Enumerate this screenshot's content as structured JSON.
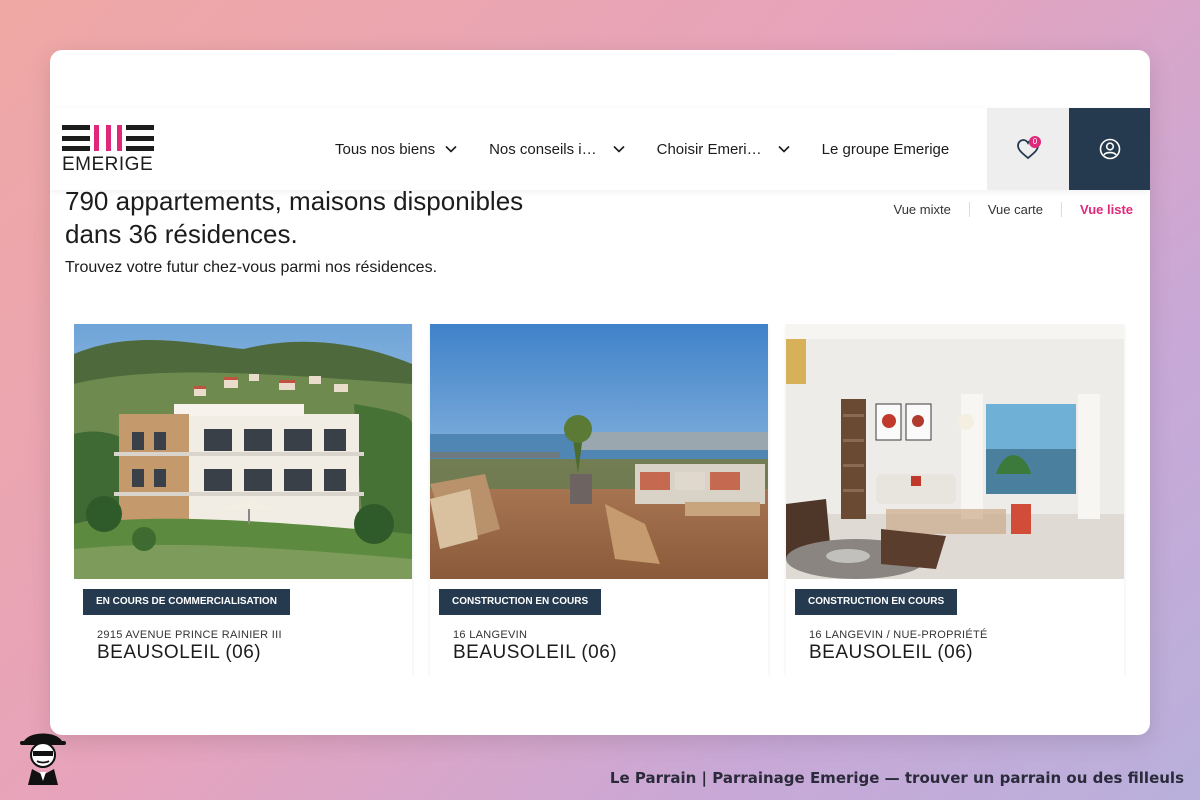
{
  "brand": {
    "name": "EMERIGE",
    "accent": "#e0287a",
    "dark": "#263a4f"
  },
  "nav": {
    "items": [
      {
        "label": "Tous nos biens",
        "has_menu": true
      },
      {
        "label": "Nos conseils i…",
        "has_menu": true
      },
      {
        "label": "Choisir Emeri…",
        "has_menu": true
      },
      {
        "label": "Le groupe Emerige",
        "has_menu": false
      }
    ],
    "favorites_count": "0",
    "favorites_icon": "heart-icon",
    "account_icon": "user-icon"
  },
  "results": {
    "line1": "790 appartements, maisons disponibles",
    "line2": "dans 36 résidences.",
    "subtitle": "Trouvez votre futur chez-vous parmi nos résidences."
  },
  "views": [
    {
      "label": "Vue mixte",
      "active": false
    },
    {
      "label": "Vue carte",
      "active": false
    },
    {
      "label": "Vue liste",
      "active": true
    }
  ],
  "listings": [
    {
      "status": "EN COURS DE COMMERCIALISATION",
      "address": "2915 AVENUE PRINCE RAINIER III",
      "city": "BEAUSOLEIL (06)"
    },
    {
      "status": "CONSTRUCTION EN COURS",
      "address": "16 LANGEVIN",
      "city": "BEAUSOLEIL (06)"
    },
    {
      "status": "CONSTRUCTION EN COURS",
      "address": "16 LANGEVIN / NUE-PROPRIÉTÉ",
      "city": "BEAUSOLEIL (06)"
    }
  ],
  "footer": {
    "caption": "Le Parrain | Parrainage Emerige — trouver un parrain ou des filleuls"
  }
}
